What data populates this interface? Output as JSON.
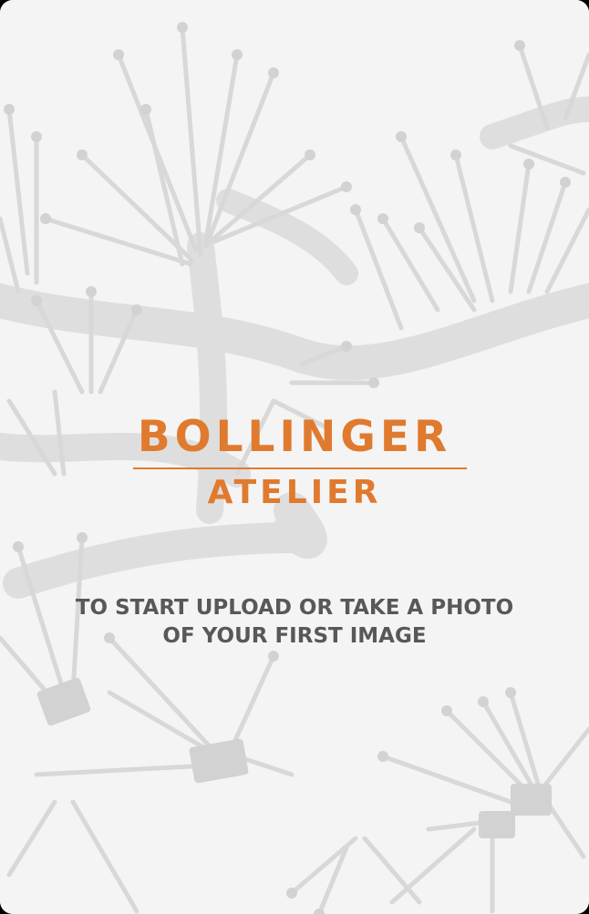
{
  "brand": {
    "line1": "BOLLINGER",
    "line2": "ATELIER",
    "color": "#e07a2e"
  },
  "upload_prompt": {
    "line1": "TO START UPLOAD OR TAKE A PHOTO",
    "line2": "OF YOUR FIRST IMAGE"
  },
  "background": {
    "subject": "faded grayscale photo of a branching metal sculpture",
    "tint": "#f4f4f4"
  }
}
